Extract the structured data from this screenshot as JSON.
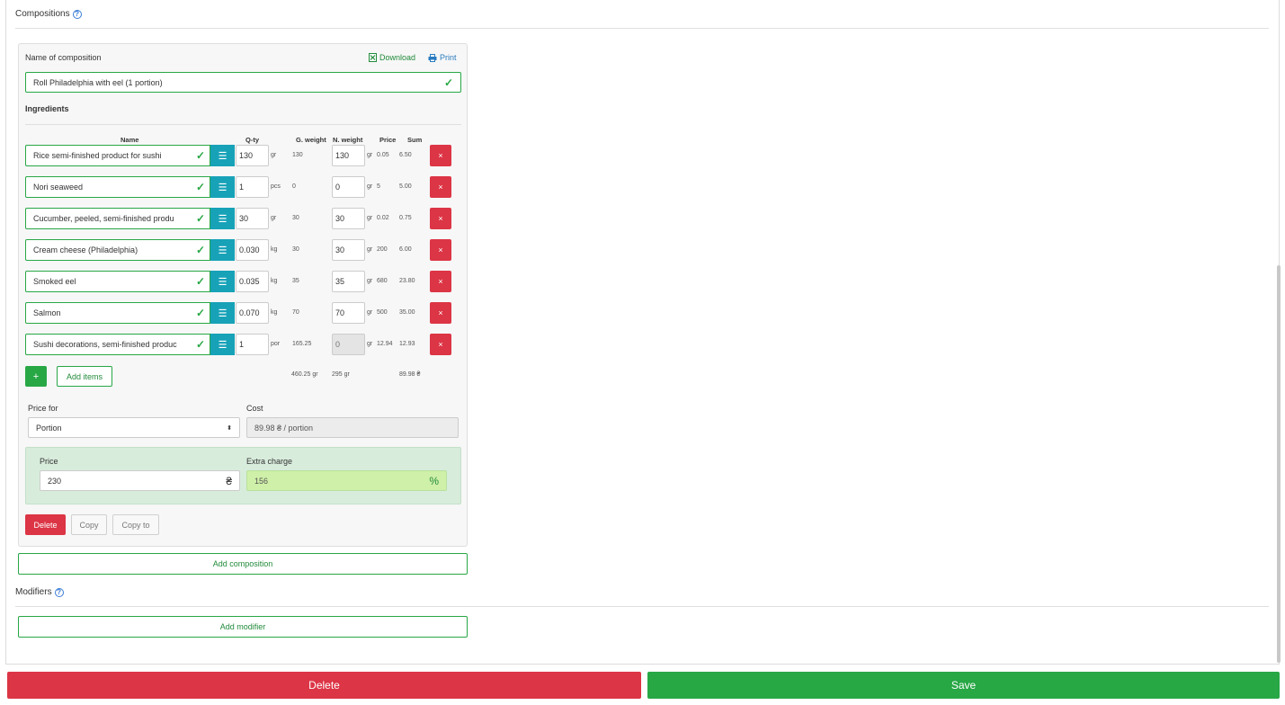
{
  "compositions": {
    "title": "Compositions",
    "card": {
      "name_label": "Name of composition",
      "download_label": "Download",
      "print_label": "Print",
      "name_value": "Roll Philadelphia with eel (1 portion)",
      "ingredients_title": "Ingredients",
      "columns": {
        "name": "Name",
        "qty": "Q-ty",
        "gross": "G. weight",
        "net": "N. weight",
        "price": "Price",
        "sum": "Sum"
      },
      "rows": [
        {
          "name": "Rice semi-finished product for sushi",
          "qty": "130",
          "unit": "gr",
          "gross": "130",
          "net": "130",
          "net_unit": "gr",
          "price": "0.05",
          "sum": "6.50"
        },
        {
          "name": "Nori seaweed",
          "qty": "1",
          "unit": "pcs",
          "gross": "0",
          "net": "0",
          "net_unit": "gr",
          "price": "5",
          "sum": "5.00"
        },
        {
          "name": "Cucumber, peeled, semi-finished produ",
          "qty": "30",
          "unit": "gr",
          "gross": "30",
          "net": "30",
          "net_unit": "gr",
          "price": "0.02",
          "sum": "0.75"
        },
        {
          "name": "Cream cheese (Philadelphia)",
          "qty": "0.030",
          "unit": "kg",
          "gross": "30",
          "net": "30",
          "net_unit": "gr",
          "price": "200",
          "sum": "6.00"
        },
        {
          "name": "Smoked eel",
          "qty": "0.035",
          "unit": "kg",
          "gross": "35",
          "net": "35",
          "net_unit": "gr",
          "price": "680",
          "sum": "23.80"
        },
        {
          "name": "Salmon",
          "qty": "0.070",
          "unit": "kg",
          "gross": "70",
          "net": "70",
          "net_unit": "gr",
          "price": "500",
          "sum": "35.00"
        },
        {
          "name": "Sushi decorations, semi-finished produc",
          "qty": "1",
          "unit": "por",
          "gross": "165.25",
          "net": "0",
          "net_unit": "gr",
          "price": "12.94",
          "sum": "12.93"
        }
      ],
      "delete_row_label": "×",
      "add_plus_label": "+",
      "add_items_label": "Add items",
      "totals": {
        "gross": "460.25 gr",
        "net": "295 gr",
        "sum": "89.98 ₴"
      },
      "price_for_label": "Price for",
      "price_for_value": "Portion",
      "cost_label": "Cost",
      "cost_value": "89.98 ₴ / portion",
      "price_label": "Price",
      "price_value": "230",
      "currency_symbol": "₴",
      "extra_charge_label": "Extra charge",
      "extra_charge_value": "156",
      "percent_symbol": "%",
      "delete_label": "Delete",
      "copy_label": "Copy",
      "copy_to_label": "Copy to"
    },
    "add_composition_label": "Add composition"
  },
  "modifiers": {
    "title": "Modifiers",
    "add_modifier_label": "Add modifier"
  },
  "footer": {
    "delete_label": "Delete",
    "save_label": "Save"
  },
  "colors": {
    "green": "#28a745",
    "red": "#dc3545",
    "teal": "#17a2b8"
  }
}
